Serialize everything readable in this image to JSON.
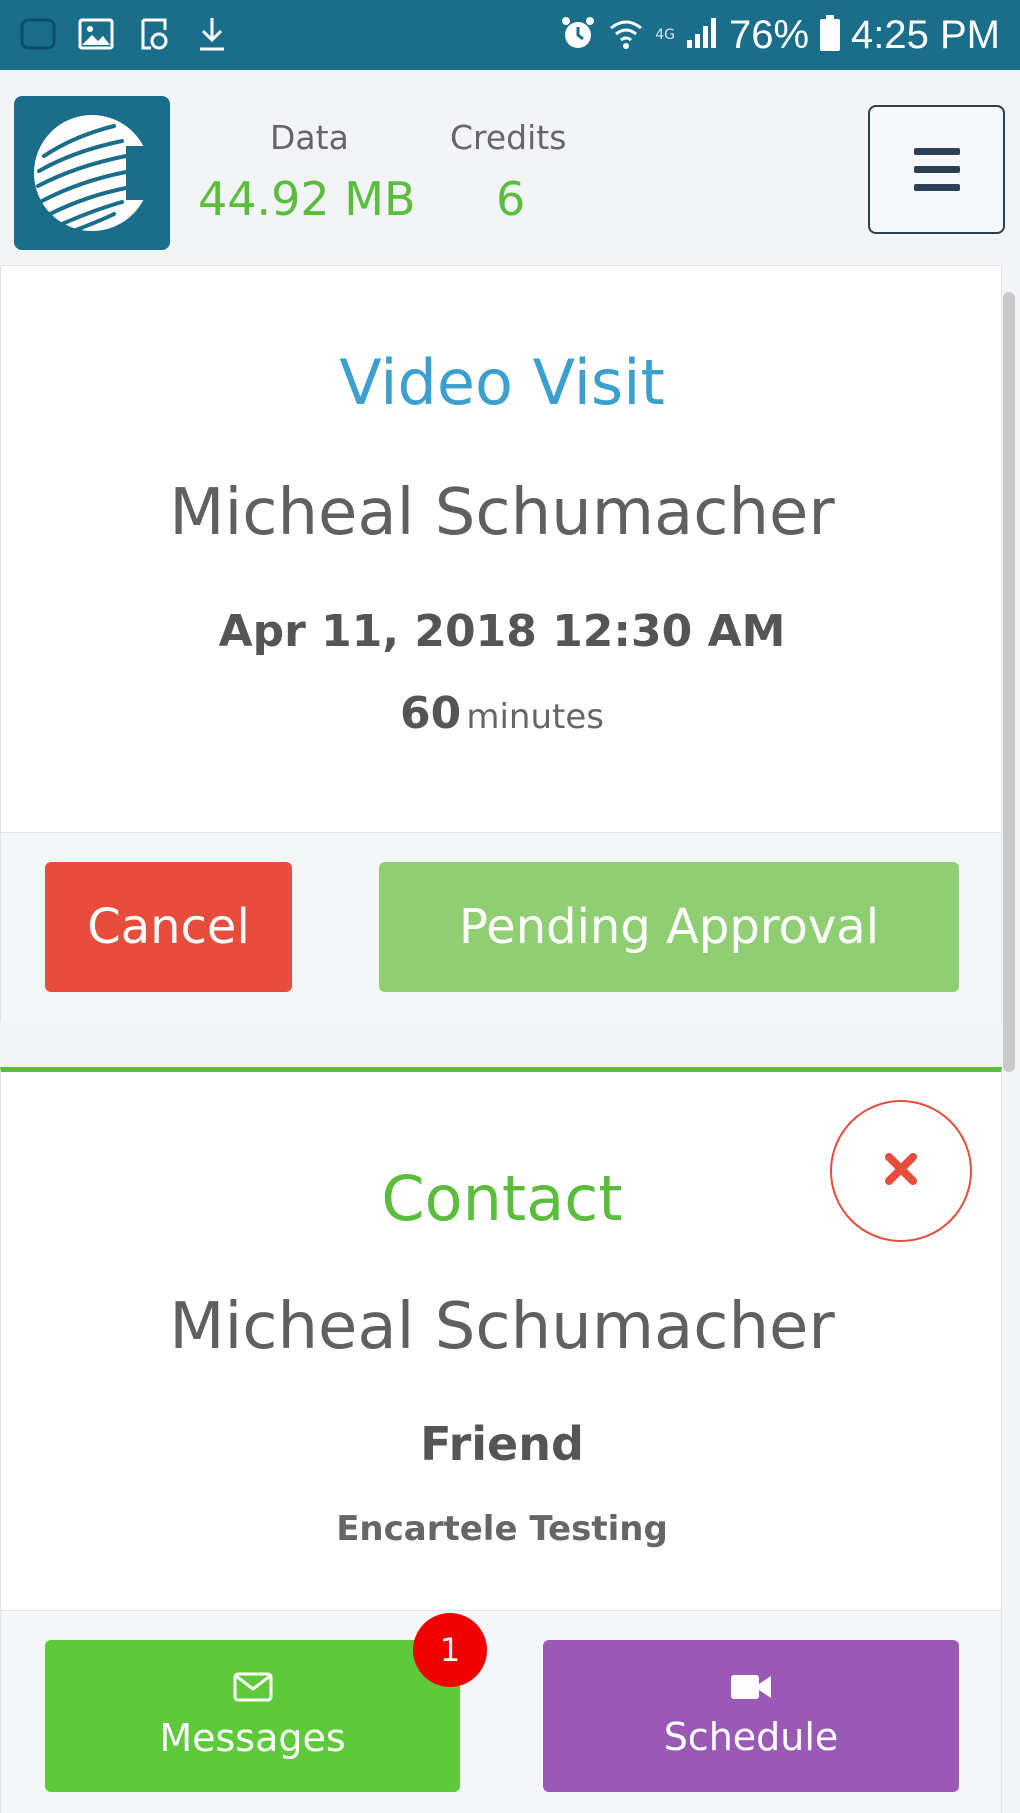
{
  "status_bar": {
    "battery": "76%",
    "time": "4:25 PM",
    "network": "4G",
    "icons": [
      "notification-icon",
      "image-icon",
      "sync-icon",
      "download-icon",
      "alarm-icon",
      "wifi-icon",
      "signal-icon",
      "battery-icon"
    ]
  },
  "header": {
    "data_label": "Data",
    "data_value": "44.92 MB",
    "credits_label": "Credits",
    "credits_value": "6"
  },
  "visit_card": {
    "title": "Video Visit",
    "name": "Micheal Schumacher",
    "datetime": "Apr 11, 2018 12:30 AM",
    "duration_value": "60",
    "duration_unit": "minutes",
    "cancel_label": "Cancel",
    "status_label": "Pending Approval"
  },
  "contact_card": {
    "title": "Contact",
    "name": "Micheal Schumacher",
    "relationship": "Friend",
    "organization": "Encartele Testing",
    "messages_label": "Messages",
    "messages_badge": "1",
    "schedule_label": "Schedule"
  },
  "colors": {
    "brand": "#1a6e8a",
    "accent_blue": "#3b9fd0",
    "accent_green": "#5bbd3c",
    "danger": "#e74c3c",
    "pending": "#8fce73",
    "messages": "#5ec93a",
    "schedule": "#9b59b6",
    "badge": "#f00000"
  }
}
